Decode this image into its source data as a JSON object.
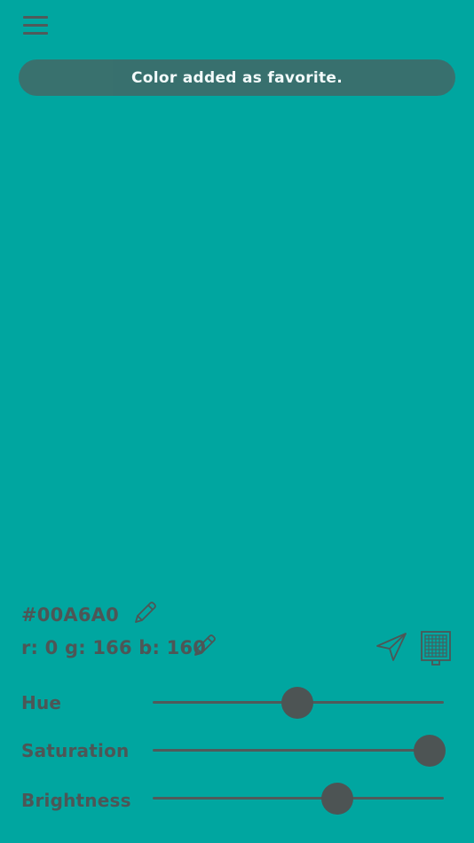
{
  "toast": {
    "message": "Color added as favorite."
  },
  "color": {
    "hex_label": "#00A6A0",
    "rgb_label": "r: 0 g: 166 b: 160",
    "value": "#00A6A0"
  },
  "sliders": [
    {
      "label": "Hue",
      "level": 0.497
    },
    {
      "label": "Saturation",
      "level": 0.95
    },
    {
      "label": "Brightness",
      "level": 0.635
    }
  ],
  "icons": {
    "menu": "hamburger-menu-icon",
    "edit_hex": "pencil-icon",
    "edit_rgb": "pencil-icon",
    "share": "send-icon",
    "palette": "palette-grid-icon"
  },
  "colors": {
    "background": "#00A6A0",
    "toast": "#3c6e6c",
    "text": "#4d5656",
    "toast_text": "#ffffff"
  }
}
